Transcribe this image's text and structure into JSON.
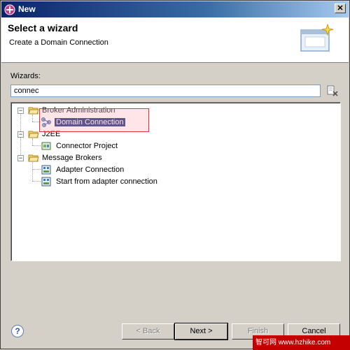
{
  "window": {
    "title": "New",
    "close_glyph": "✕"
  },
  "header": {
    "title": "Select a wizard",
    "description": "Create a Domain Connection"
  },
  "filter": {
    "label": "Wizards:",
    "value": "connec"
  },
  "tree": {
    "nodes": [
      {
        "label": "Broker Administration",
        "type": "folder",
        "expanded": true,
        "icon": "folder-open-icon"
      },
      {
        "label": "Domain Connection",
        "type": "item",
        "selected": true,
        "icon": "domain-connection-icon"
      },
      {
        "label": "J2EE",
        "type": "folder",
        "expanded": true,
        "icon": "folder-open-icon"
      },
      {
        "label": "Connector Project",
        "type": "item",
        "icon": "connector-project-icon"
      },
      {
        "label": "Message Brokers",
        "type": "folder",
        "expanded": true,
        "icon": "folder-open-icon"
      },
      {
        "label": "Adapter Connection",
        "type": "item",
        "icon": "adapter-connection-icon"
      },
      {
        "label": "Start from adapter connection",
        "type": "item",
        "icon": "adapter-connection-icon"
      }
    ]
  },
  "buttons": {
    "help": "?",
    "back": "< Back",
    "next": "Next >",
    "finish": "Finish",
    "cancel": "Cancel"
  },
  "watermark": "智可网  www.hzhike.com",
  "colors": {
    "selection": "#0a246a",
    "highlight_border": "#e8313a",
    "title_gradient_start": "#0a246a"
  }
}
